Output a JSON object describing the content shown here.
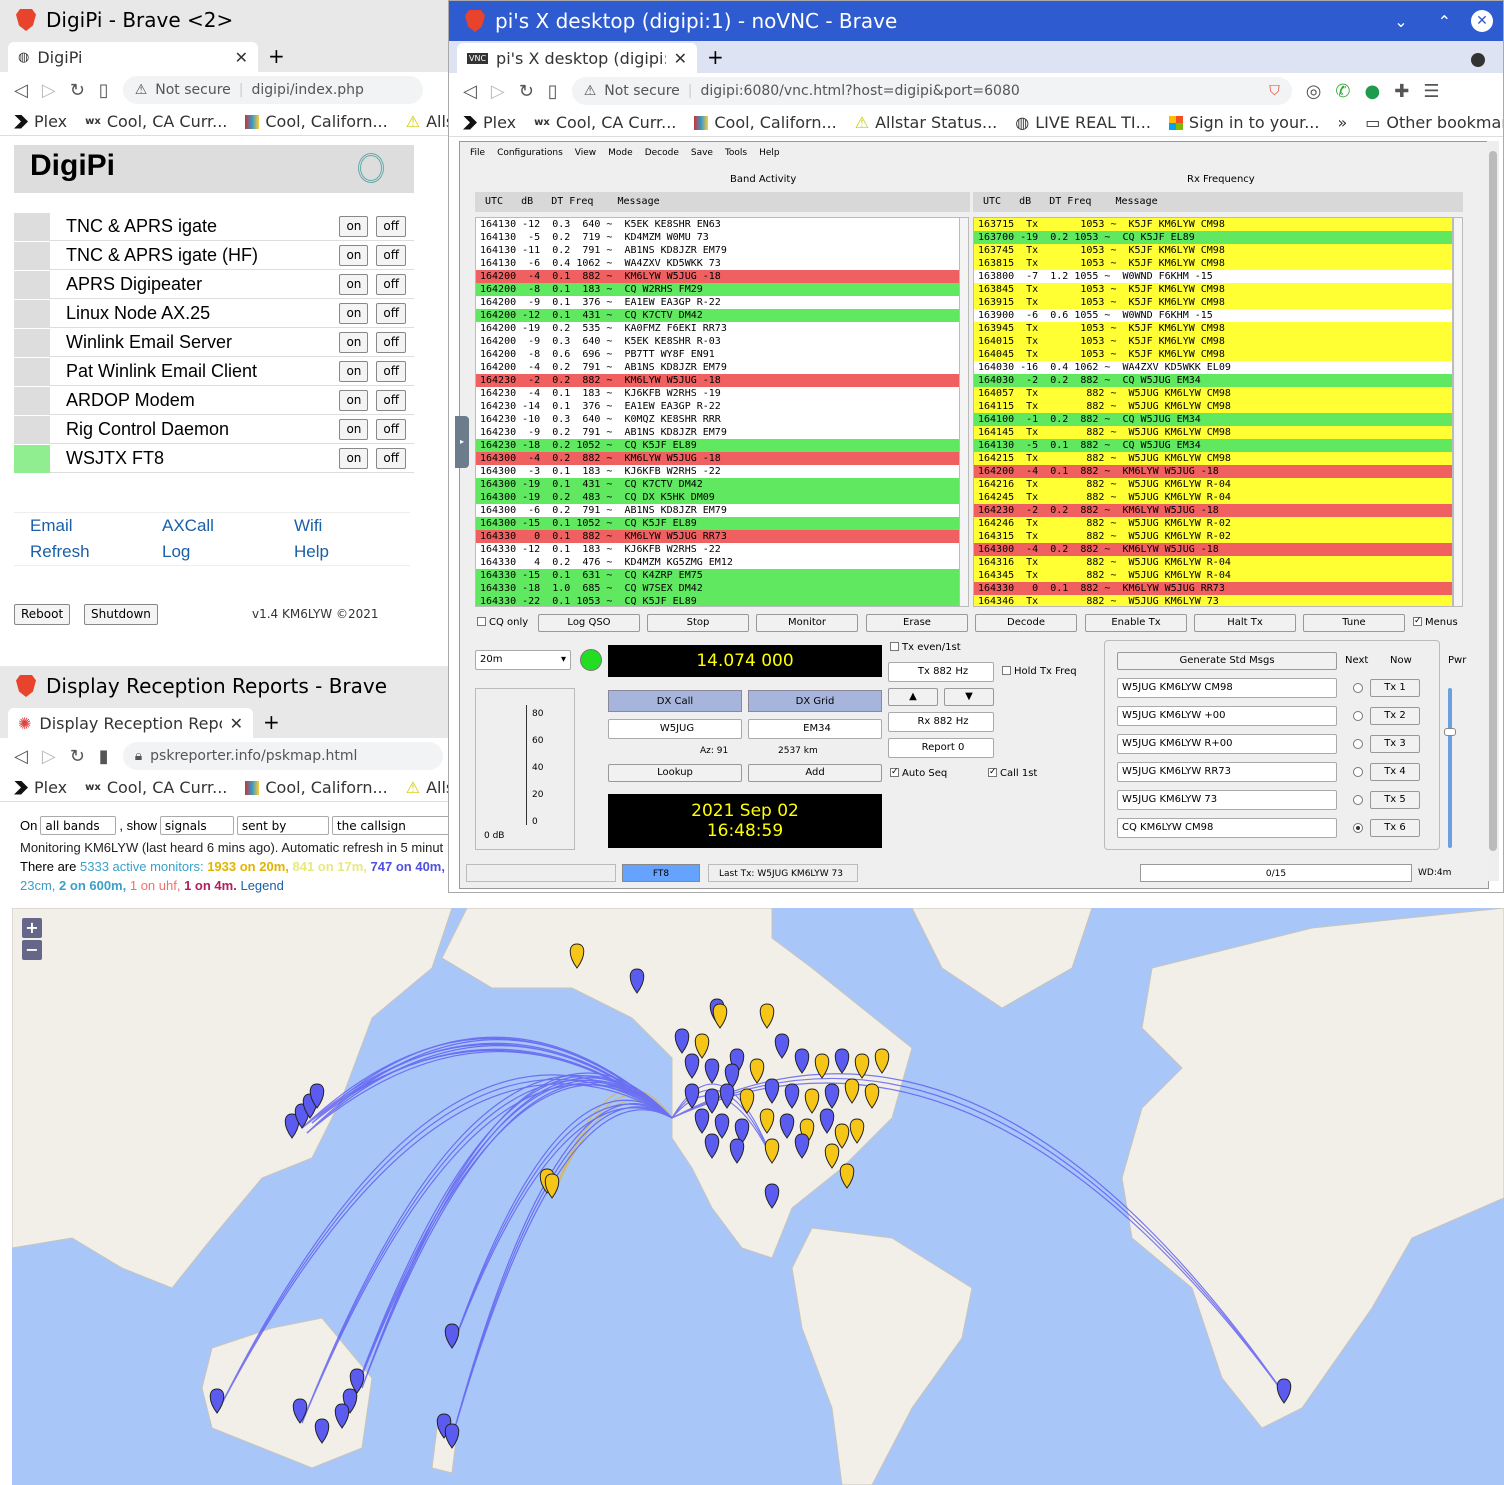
{
  "digipi": {
    "title": "DigiPi - Brave <2>",
    "tab": "DigiPi",
    "url_warning": "Not secure",
    "url": "digipi/index.php",
    "bookmarks": [
      "Plex",
      "Cool, CA Curr...",
      "Cool, Californ...",
      "Alls"
    ],
    "heading": "DigiPi",
    "services": [
      {
        "name": "TNC & APRS igate",
        "active": false
      },
      {
        "name": "TNC & APRS igate (HF)",
        "active": false
      },
      {
        "name": "APRS Digipeater",
        "active": false
      },
      {
        "name": "Linux Node AX.25",
        "active": false
      },
      {
        "name": "Winlink Email Server",
        "active": false
      },
      {
        "name": "Pat Winlink Email Client",
        "active": false
      },
      {
        "name": "ARDOP Modem",
        "active": false
      },
      {
        "name": "Rig Control Daemon",
        "active": false
      },
      {
        "name": "WSJTX FT8",
        "active": true
      }
    ],
    "on": "on",
    "off": "off",
    "links": [
      "Email",
      "AXCall",
      "Wifi",
      "Refresh",
      "Log",
      "Help"
    ],
    "reboot": "Reboot",
    "shutdown": "Shutdown",
    "version": "v1.4 KM6LYW ©2021",
    "active_color": "#90ee90"
  },
  "vnc": {
    "title": "pi's X desktop (digipi:1) - noVNC - Brave",
    "tab": "pi's X desktop (digipi:1) - r",
    "url_warning": "Not secure",
    "url": "digipi:6080/vnc.html?host=digipi&port=6080",
    "bookmarks": [
      "Plex",
      "Cool, CA Curr...",
      "Cool, Californ...",
      "Allstar Status...",
      "LIVE REAL TI...",
      "Sign in to your...",
      "»",
      "Other bookmarks"
    ]
  },
  "wsjt": {
    "menu": [
      "File",
      "Configurations",
      "View",
      "Mode",
      "Decode",
      "Save",
      "Tools",
      "Help"
    ],
    "band_activity": "Band Activity",
    "rx_frequency": "Rx Frequency",
    "header": " UTC   dB   DT Freq    Message",
    "band_rows": [
      {
        "t": "164130 -12  0.3  640 ~  K5EK KE8SHR EN63",
        "c": ""
      },
      {
        "t": "164130  -5  0.2  719 ~  KD4MZM W0MU 73",
        "c": ""
      },
      {
        "t": "164130 -11  0.2  791 ~  AB1NS KD8JZR EM79",
        "c": ""
      },
      {
        "t": "164130  -6  0.4 1062 ~  WA4ZXV KD5WKK 73",
        "c": ""
      },
      {
        "t": "164200  -4  0.1  882 ~  KM6LYW W5JUG -18",
        "c": "r"
      },
      {
        "t": "164200  -8  0.1  183 ~  CQ W2RHS FM29",
        "c": "g"
      },
      {
        "t": "164200  -9  0.1  376 ~  EA1EW EA3GP R-22",
        "c": ""
      },
      {
        "t": "164200 -12  0.1  431 ~  CQ K7CTV DM42",
        "c": "g"
      },
      {
        "t": "164200 -19  0.2  535 ~  KA0FMZ F6EKI RR73",
        "c": ""
      },
      {
        "t": "164200  -9  0.3  640 ~  K5EK KE8SHR R-03",
        "c": ""
      },
      {
        "t": "164200  -8  0.6  696 ~  PB7TT WY8F EN91",
        "c": ""
      },
      {
        "t": "164200  -4  0.2  791 ~  AB1NS KD8JZR EM79",
        "c": ""
      },
      {
        "t": "164230  -2  0.2  882 ~  KM6LYW W5JUG -18",
        "c": "r"
      },
      {
        "t": "164230  -4  0.1  183 ~  KJ6KFB W2RHS -19",
        "c": ""
      },
      {
        "t": "164230 -14  0.1  376 ~  EA1EW EA3GP R-22",
        "c": ""
      },
      {
        "t": "164230 -10  0.3  640 ~  K0MQZ KE8SHR RRR",
        "c": ""
      },
      {
        "t": "164230  -9  0.2  791 ~  AB1NS KD8JZR EM79",
        "c": ""
      },
      {
        "t": "164230 -18  0.2 1052 ~  CQ K5JF EL89",
        "c": "g"
      },
      {
        "t": "164300  -4  0.2  882 ~  KM6LYW W5JUG -18",
        "c": "r"
      },
      {
        "t": "164300  -3  0.1  183 ~  KJ6KFB W2RHS -22",
        "c": ""
      },
      {
        "t": "164300 -19  0.1  431 ~  CQ K7CTV DM42",
        "c": "g"
      },
      {
        "t": "164300 -19  0.2  483 ~  CQ DX K5HK DM09",
        "c": "g"
      },
      {
        "t": "164300  -6  0.2  791 ~  AB1NS KD8JZR EM79",
        "c": ""
      },
      {
        "t": "164300 -15  0.1 1052 ~  CQ K5JF EL89",
        "c": "g"
      },
      {
        "t": "164330   0  0.1  882 ~  KM6LYW W5JUG RR73",
        "c": "r"
      },
      {
        "t": "164330 -12  0.1  183 ~  KJ6KFB W2RHS -22",
        "c": ""
      },
      {
        "t": "164330   4  0.2  476 ~  KD4MZM KG5ZMG EM12",
        "c": ""
      },
      {
        "t": "164330 -15  0.1  631 ~  CQ K4ZRP EM75",
        "c": "g"
      },
      {
        "t": "164330 -18  1.0  685 ~  CQ W7SEX DM42",
        "c": "g"
      },
      {
        "t": "164330 -22  0.1 1053 ~  CQ K5JF EL89",
        "c": "g"
      }
    ],
    "rx_rows": [
      {
        "t": "163715  Tx       1053 ~  K5JF KM6LYW CM98",
        "c": "y"
      },
      {
        "t": "163700 -19  0.2 1053 ~  CQ K5JF EL89",
        "c": "g"
      },
      {
        "t": "163745  Tx       1053 ~  K5JF KM6LYW CM98",
        "c": "y"
      },
      {
        "t": "163815  Tx       1053 ~  K5JF KM6LYW CM98",
        "c": "y"
      },
      {
        "t": "163800  -7  1.2 1055 ~  W0WND F6KHM -15",
        "c": ""
      },
      {
        "t": "163845  Tx       1053 ~  K5JF KM6LYW CM98",
        "c": "y"
      },
      {
        "t": "163915  Tx       1053 ~  K5JF KM6LYW CM98",
        "c": "y"
      },
      {
        "t": "163900  -6  0.6 1055 ~  W0WND F6KHM -15",
        "c": ""
      },
      {
        "t": "163945  Tx       1053 ~  K5JF KM6LYW CM98",
        "c": "y"
      },
      {
        "t": "164015  Tx       1053 ~  K5JF KM6LYW CM98",
        "c": "y"
      },
      {
        "t": "164045  Tx       1053 ~  K5JF KM6LYW CM98",
        "c": "y"
      },
      {
        "t": "164030 -16  0.4 1062 ~  WA4ZXV KD5WKK EL09",
        "c": ""
      },
      {
        "t": "164030  -2  0.2  882 ~  CQ W5JUG EM34",
        "c": "g"
      },
      {
        "t": "164057  Tx        882 ~  W5JUG KM6LYW CM98",
        "c": "y"
      },
      {
        "t": "164115  Tx        882 ~  W5JUG KM6LYW CM98",
        "c": "y"
      },
      {
        "t": "164100  -1  0.2  882 ~  CQ W5JUG EM34",
        "c": "g"
      },
      {
        "t": "164145  Tx        882 ~  W5JUG KM6LYW CM98",
        "c": "y"
      },
      {
        "t": "164130  -5  0.1  882 ~  CQ W5JUG EM34",
        "c": "g"
      },
      {
        "t": "164215  Tx        882 ~  W5JUG KM6LYW CM98",
        "c": "y"
      },
      {
        "t": "164200  -4  0.1  882 ~  KM6LYW W5JUG -18",
        "c": "r"
      },
      {
        "t": "164216  Tx        882 ~  W5JUG KM6LYW R-04",
        "c": "y"
      },
      {
        "t": "164245  Tx        882 ~  W5JUG KM6LYW R-04",
        "c": "y"
      },
      {
        "t": "164230  -2  0.2  882 ~  KM6LYW W5JUG -18",
        "c": "r"
      },
      {
        "t": "164246  Tx        882 ~  W5JUG KM6LYW R-02",
        "c": "y"
      },
      {
        "t": "164315  Tx        882 ~  W5JUG KM6LYW R-02",
        "c": "y"
      },
      {
        "t": "164300  -4  0.2  882 ~  KM6LYW W5JUG -18",
        "c": "r"
      },
      {
        "t": "164316  Tx        882 ~  W5JUG KM6LYW R-04",
        "c": "y"
      },
      {
        "t": "164345  Tx        882 ~  W5JUG KM6LYW R-04",
        "c": "y"
      },
      {
        "t": "164330   0  0.1  882 ~  KM6LYW W5JUG RR73",
        "c": "r"
      },
      {
        "t": "164346  Tx        882 ~  W5JUG KM6LYW 73",
        "c": "y"
      }
    ],
    "cq_only": "CQ only",
    "buttons": [
      "Log QSO",
      "Stop",
      "Monitor",
      "Erase",
      "Decode",
      "Enable Tx",
      "Halt Tx",
      "Tune"
    ],
    "menus": "Menus",
    "band": "20m",
    "frequency": "14.074 000",
    "tx_even": "Tx even/1st",
    "tx_hz": "Tx  882  Hz",
    "hold_tx": "Hold Tx Freq",
    "rx_hz": "Rx  882  Hz",
    "report": "Report 0",
    "auto_seq": "Auto Seq",
    "call_1st": "Call 1st",
    "dx_call_label": "DX Call",
    "dx_grid_label": "DX Grid",
    "dx_call": "W5JUG",
    "dx_grid": "EM34",
    "az": "Az: 91",
    "km": "2537 km",
    "lookup": "Lookup",
    "add": "Add",
    "date": "2021 Sep 02",
    "time": "16:48:59",
    "meter_ticks": [
      "80",
      "60",
      "40",
      "20",
      "0"
    ],
    "meter_db": "0 dB",
    "gen_std": "Generate Std Msgs",
    "next": "Next",
    "now": "Now",
    "pwr": "Pwr",
    "tx_msgs": [
      "W5JUG KM6LYW CM98",
      "W5JUG KM6LYW +00",
      "W5JUG KM6LYW R+00",
      "W5JUG KM6LYW RR73",
      "W5JUG KM6LYW 73",
      "CQ KM6LYW CM98"
    ],
    "tx_btns": [
      "Tx 1",
      "Tx 2",
      "Tx 3",
      "Tx 4",
      "Tx 5",
      "Tx 6"
    ],
    "mode": "FT8",
    "last_tx": "Last Tx: W5JUG KM6LYW 73",
    "progress": "0/15",
    "wd": "WD:4m"
  },
  "psk": {
    "title": "Display Reception Reports - Brave",
    "tab": "Display Reception Reports",
    "url": "pskreporter.info/pskmap.html",
    "bookmarks": [
      "Plex",
      "Cool, CA Curr...",
      "Cool, Californ...",
      "Alls"
    ],
    "on": "On",
    "bands": "all bands",
    "show": ", show",
    "signals": "signals",
    "sent_by": "sent by",
    "callsign": "the callsign",
    "monitoring": "Monitoring KM6LYW (last heard 6 mins ago). Automatic refresh in 5 minut",
    "there_are": "There are",
    "monitors": "5333 active monitors:",
    "m20": "1933 on 20m,",
    "m17": "841 on 17m,",
    "m40": "747 on 40m,",
    "m23": "23cm,",
    "m600": "2 on 600m,",
    "muhf": "1 on uhf,",
    "m4": "1 on 4m.",
    "legend": "Legend",
    "zoom_in": "+",
    "zoom_out": "−",
    "colors": {
      "ocean": "#a9c6f9",
      "land": "#f2efe9",
      "blue_marker": "#5b5bf0",
      "yellow_marker": "#f5c518"
    }
  }
}
